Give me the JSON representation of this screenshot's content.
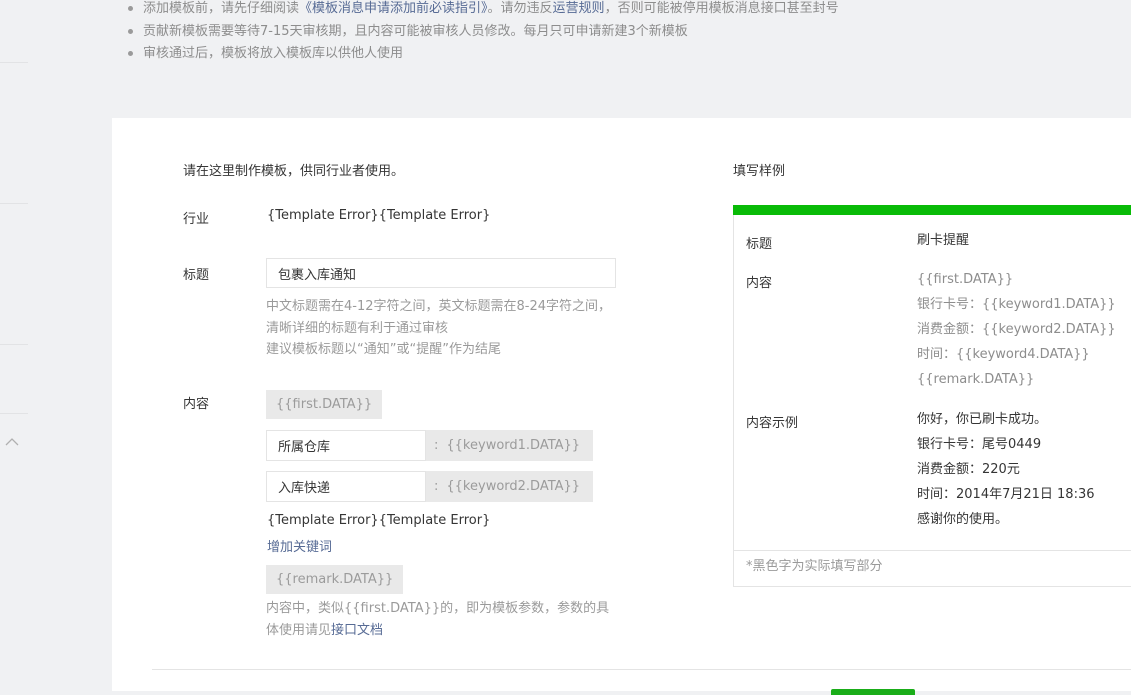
{
  "notices": [
    {
      "before": "添加模板前，请先仔细阅读",
      "link1": "《模板消息申请添加前必读指引》",
      "middle": "。请勿违反",
      "link2": "运营规则",
      "after": "，否则可能被停用模板消息接口甚至封号"
    },
    {
      "before": "贡献新模板需要等待7-15天审核期，且内容可能被审核人员修改。每月只可申请新建3个新模板"
    },
    {
      "before": "审核通过后，模板将放入模板库以供他人使用"
    }
  ],
  "form": {
    "intro": "请在这里制作模板，供同行业者使用。",
    "industry": {
      "label": "行业",
      "value": "{Template Error}{Template Error}"
    },
    "title": {
      "label": "标题",
      "value": "包裹入库通知",
      "hint_line1": "中文标题需在4-12字符之间，英文标题需在8-24字符之间，清晰详细的标题有利于通过审核",
      "hint_line2": "建议模板标题以“通知”或“提醒”作为结尾"
    },
    "content": {
      "label": "内容",
      "first_param": "{{first.DATA}}",
      "keywords": [
        {
          "name": "所属仓库",
          "param": "{{keyword1.DATA}}"
        },
        {
          "name": "入库快递",
          "param": "{{keyword2.DATA}}"
        }
      ],
      "colon": ":",
      "error_text": "{Template Error}{Template Error}",
      "add_keyword": "增加关键词",
      "remark_param": "{{remark.DATA}}",
      "hint_before": "内容中，类似{{first.DATA}}的，即为模板参数，参数的具体使用请见",
      "hint_link": "接口文档"
    }
  },
  "example": {
    "heading": "填写样例",
    "title_label": "标题",
    "title_value": "刷卡提醒",
    "content_label": "内容",
    "content_lines": [
      "{{first.DATA}}",
      "银行卡号：{{keyword1.DATA}}",
      "消费金额：{{keyword2.DATA}}",
      "时间：{{keyword4.DATA}}",
      "{{remark.DATA}}"
    ],
    "sample_label": "内容示例",
    "sample_lines": [
      "你好，你已刷卡成功。",
      "银行卡号：尾号0449",
      "消费金额：220元",
      "时间：2014年7月21日 18:36",
      "感谢你的使用。"
    ],
    "footer": "*黑色字为实际填写部分"
  },
  "colors": {
    "accent_green": "#09bb07",
    "link_blue": "#576b95"
  },
  "icons": {
    "side_toggle": "chevron-up-icon"
  }
}
